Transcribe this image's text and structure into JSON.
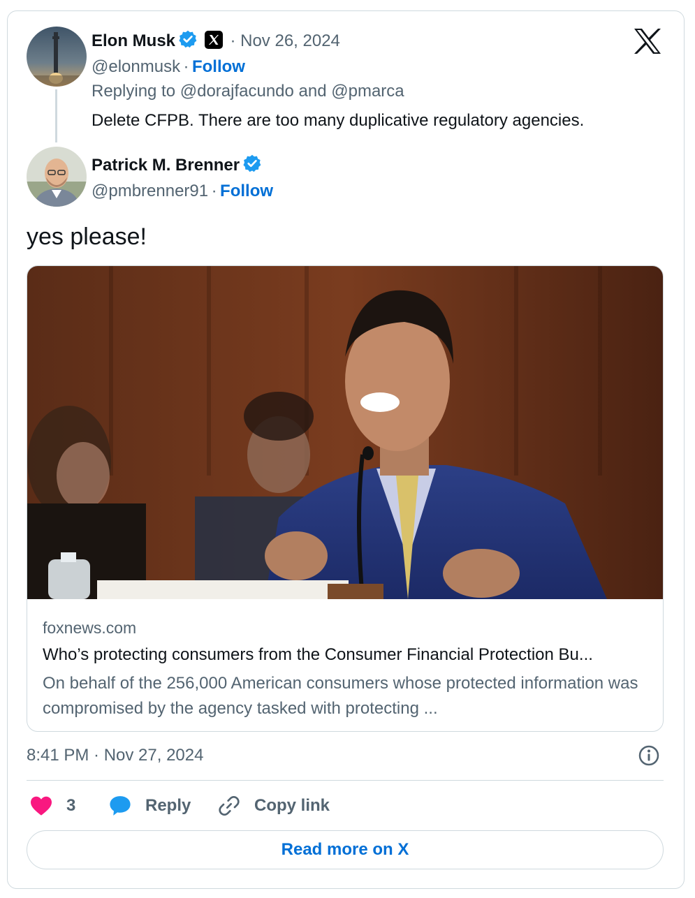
{
  "parent_tweet": {
    "author_name": "Elon Musk",
    "handle": "@elonmusk",
    "separator": "·",
    "follow_label": "Follow",
    "date": "· Nov 26, 2024",
    "replying_to": "Replying to @dorajfacundo and @pmarca",
    "text": "Delete CFPB. There are too many duplicative regulatory agencies."
  },
  "tweet": {
    "author_name": "Patrick M. Brenner",
    "handle": "@pmbrenner91",
    "separator": "·",
    "follow_label": "Follow",
    "text": "yes please!",
    "timestamp": "8:41 PM · Nov 27, 2024"
  },
  "link_card": {
    "domain": "foxnews.com",
    "title": "Who’s protecting consumers from the Consumer Financial Protection Bu...",
    "description": "On behalf of the 256,000 American consumers whose protected information was compromised by the agency tasked with protecting ..."
  },
  "actions": {
    "like_count": "3",
    "reply_label": "Reply",
    "copy_link_label": "Copy link"
  },
  "read_more_label": "Read more on X",
  "colors": {
    "accent_blue": "#006fd6",
    "verified_blue": "#1d9bf0",
    "like_pink": "#f91880",
    "muted": "#536471",
    "border": "#cfd9de"
  },
  "icons": [
    "x-logo-icon",
    "verified-icon",
    "x-affiliate-icon",
    "info-icon",
    "heart-icon",
    "reply-bubble-icon",
    "link-icon"
  ]
}
